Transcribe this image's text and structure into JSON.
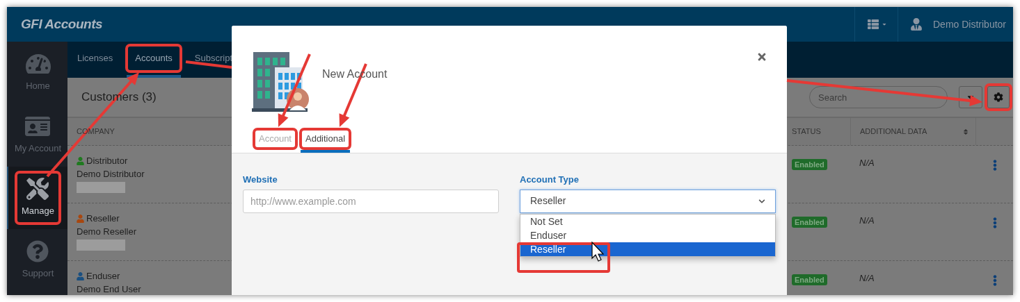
{
  "app": {
    "title": "GFI Accounts",
    "user": "Demo Distributor"
  },
  "sidebar": {
    "items": [
      {
        "kind": "home",
        "label": "Home",
        "selected": false,
        "highlighted": false
      },
      {
        "kind": "account",
        "label": "My Account",
        "selected": false,
        "highlighted": false
      },
      {
        "kind": "manage",
        "label": "Manage",
        "selected": true,
        "highlighted": true
      },
      {
        "kind": "support",
        "label": "Support",
        "selected": false,
        "highlighted": false
      }
    ]
  },
  "subnav": {
    "tabs": [
      {
        "label": "Licenses",
        "selected": false,
        "highlighted": false
      },
      {
        "label": "Accounts",
        "selected": true,
        "highlighted": true
      },
      {
        "label": "Subscript",
        "selected": false,
        "highlighted": false
      }
    ]
  },
  "list": {
    "title": "Customers (3)",
    "search_placeholder": "Search",
    "settings_highlighted": true,
    "columns": [
      "COMPANY",
      "STATUS",
      "ADDITIONAL DATA"
    ],
    "rows": [
      {
        "type": "Distributor",
        "color": "#1f7a1f",
        "name": "Demo Distributor",
        "redacted": true,
        "status": "Enabled",
        "additional": "N/A"
      },
      {
        "type": "Reseller",
        "color": "#a8470f",
        "name": "Demo Reseller",
        "redacted": true,
        "status": "Enabled",
        "additional": "N/A"
      },
      {
        "type": "Enduser",
        "color": "#1a4f80",
        "name": "Demo End User",
        "redacted": false,
        "status": "Enabled",
        "additional": "N/A"
      }
    ]
  },
  "modal": {
    "title": "New Account",
    "tabs": [
      {
        "label": "Account",
        "selected": false,
        "highlighted": true
      },
      {
        "label": "Additional",
        "selected": true,
        "highlighted": true
      }
    ],
    "fields": [
      {
        "kind": "text",
        "label": "Website",
        "placeholder": "http://www.example.com"
      },
      {
        "kind": "select",
        "label": "Account Type",
        "value": "Reseller",
        "expanded": true,
        "options": [
          {
            "label": "Not Set",
            "selected": false,
            "highlighted": false
          },
          {
            "label": "Enduser",
            "selected": false,
            "highlighted": false
          },
          {
            "label": "Reseller",
            "selected": true,
            "highlighted": true
          }
        ]
      }
    ]
  }
}
